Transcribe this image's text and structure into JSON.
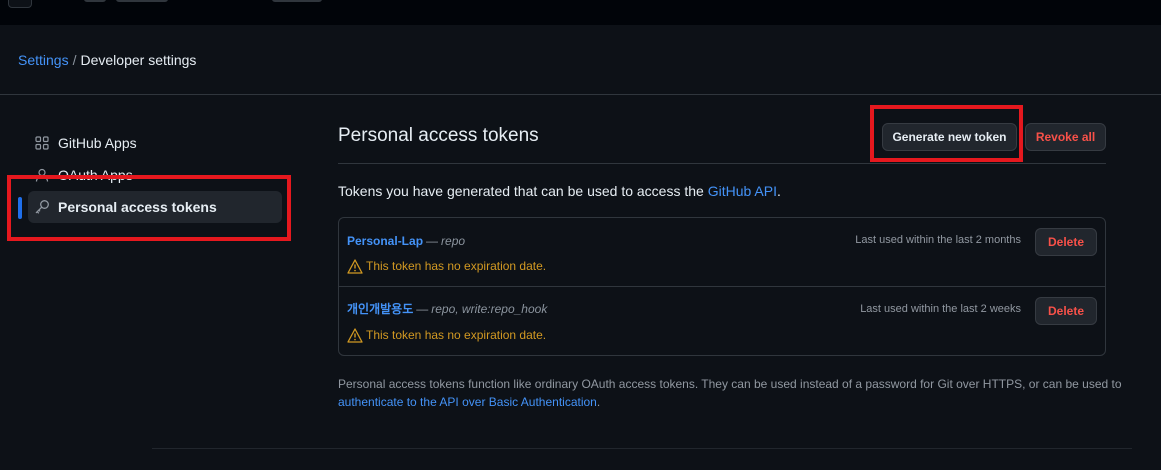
{
  "breadcrumb": {
    "settings": "Settings",
    "separator": "/",
    "current": "Developer settings"
  },
  "sidebar": {
    "items": [
      {
        "label": "GitHub Apps",
        "icon": "apps-grid-icon"
      },
      {
        "label": "OAuth Apps",
        "icon": "person-icon"
      },
      {
        "label": "Personal access tokens",
        "icon": "key-icon",
        "active": true
      }
    ]
  },
  "main": {
    "title": "Personal access tokens",
    "generate_label": "Generate new token",
    "revoke_label": "Revoke all",
    "intro_text": "Tokens you have generated that can be used to access the ",
    "intro_link": "GitHub API",
    "intro_end": "."
  },
  "tokens": [
    {
      "name": "Personal-Lap",
      "dash": "—",
      "scopes": "repo",
      "last_used": "Last used within the last 2 months",
      "warning": "This token has no expiration date.",
      "delete_label": "Delete"
    },
    {
      "name": "개인개발용도",
      "dash": "—",
      "scopes": "repo, write:repo_hook",
      "last_used": "Last used within the last 2 weeks",
      "warning": "This token has no expiration date.",
      "delete_label": "Delete"
    }
  ],
  "footnote": {
    "text": "Personal access tokens function like ordinary OAuth access tokens. They can be used instead of a password for Git over HTTPS, or can be used to ",
    "link": "authenticate to the API over Basic Authentication",
    "end": "."
  },
  "colors": {
    "background": "#0d1117",
    "accent_link": "#4493f8",
    "danger": "#f85149",
    "warning": "#d29922",
    "highlight_box": "#e5181e"
  }
}
